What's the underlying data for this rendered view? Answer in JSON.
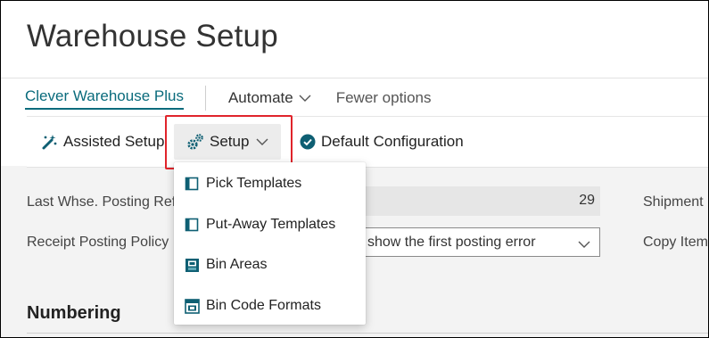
{
  "page": {
    "title": "Warehouse Setup"
  },
  "actionbar": {
    "promoted_tab": "Clever Warehouse Plus",
    "automate_label": "Automate",
    "fewer_options_label": "Fewer options"
  },
  "toolbar": {
    "assisted_setup_label": "Assisted Setup",
    "setup_label": "Setup",
    "default_configuration_label": "Default Configuration"
  },
  "setup_menu": {
    "items": [
      {
        "label": "Pick Templates",
        "icon": "template-page-icon"
      },
      {
        "label": "Put-Away Templates",
        "icon": "template-page-icon"
      },
      {
        "label": "Bin Areas",
        "icon": "bin-area-icon"
      },
      {
        "label": "Bin Code Formats",
        "icon": "bin-code-format-icon"
      }
    ]
  },
  "fields": {
    "last_whse_posting_ref": {
      "label": "Last Whse. Posting Ref",
      "value": "29"
    },
    "receipt_posting_policy": {
      "label": "Receipt Posting Policy",
      "value": "show the first posting error"
    },
    "shipment_label_partial": "Shipment",
    "copy_item_label_partial": "Copy Item"
  },
  "sections": {
    "numbering": "Numbering"
  },
  "colors": {
    "accent": "#0a6b7c",
    "highlight": "#e0242b",
    "action_icon": "#0e5f73"
  }
}
